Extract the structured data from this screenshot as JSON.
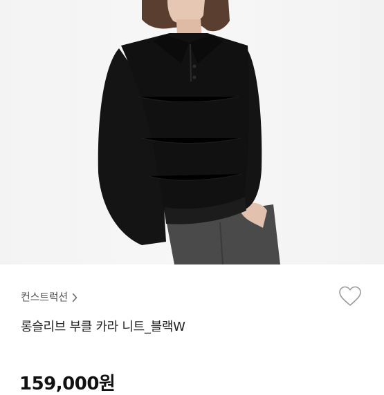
{
  "product": {
    "brand": "컨스트럭션",
    "title": "롱슬리브 부클 카라 니트_블랙W",
    "price": "159,000원"
  },
  "icons": {
    "brand_chevron": "chevron-right-icon",
    "like": "heart-outline-icon"
  },
  "colors": {
    "knit": "#111111",
    "pants": "#4a4a4a",
    "background": "#f5f5f5",
    "icon_stroke": "#9a9a9a"
  }
}
